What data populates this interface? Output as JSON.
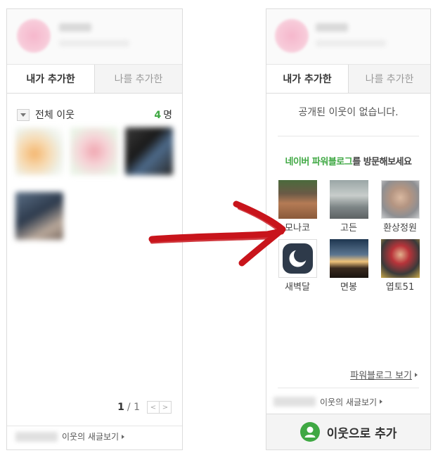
{
  "left": {
    "tabs": [
      "내가 추가한",
      "나를 추가한"
    ],
    "group_label": "전체 이웃",
    "count_num": "4",
    "count_unit": "명",
    "pager_current": "1",
    "pager_total": "/ 1",
    "pager_prev": "<",
    "pager_next": ">",
    "new_posts_link": "이웃의 새글보기"
  },
  "right": {
    "tabs": [
      "내가 추가한",
      "나를 추가한"
    ],
    "empty_message": "공개된 이웃이 없습니다.",
    "promo_highlight": "네이버 파워블로그",
    "promo_rest": "를 방문해보세요",
    "powerbloggers": [
      {
        "name": "모나코"
      },
      {
        "name": "고든"
      },
      {
        "name": "환상정원"
      },
      {
        "name": "새벽달"
      },
      {
        "name": "면봉"
      },
      {
        "name": "엽토51"
      }
    ],
    "powerblog_more": "파워블로그 보기",
    "new_posts_link": "이웃의 새글보기",
    "add_button": "이웃으로 추가"
  },
  "colors": {
    "accent_green": "#3fa843",
    "arrow_red": "#c8141b",
    "border": "#dcdcdc"
  }
}
